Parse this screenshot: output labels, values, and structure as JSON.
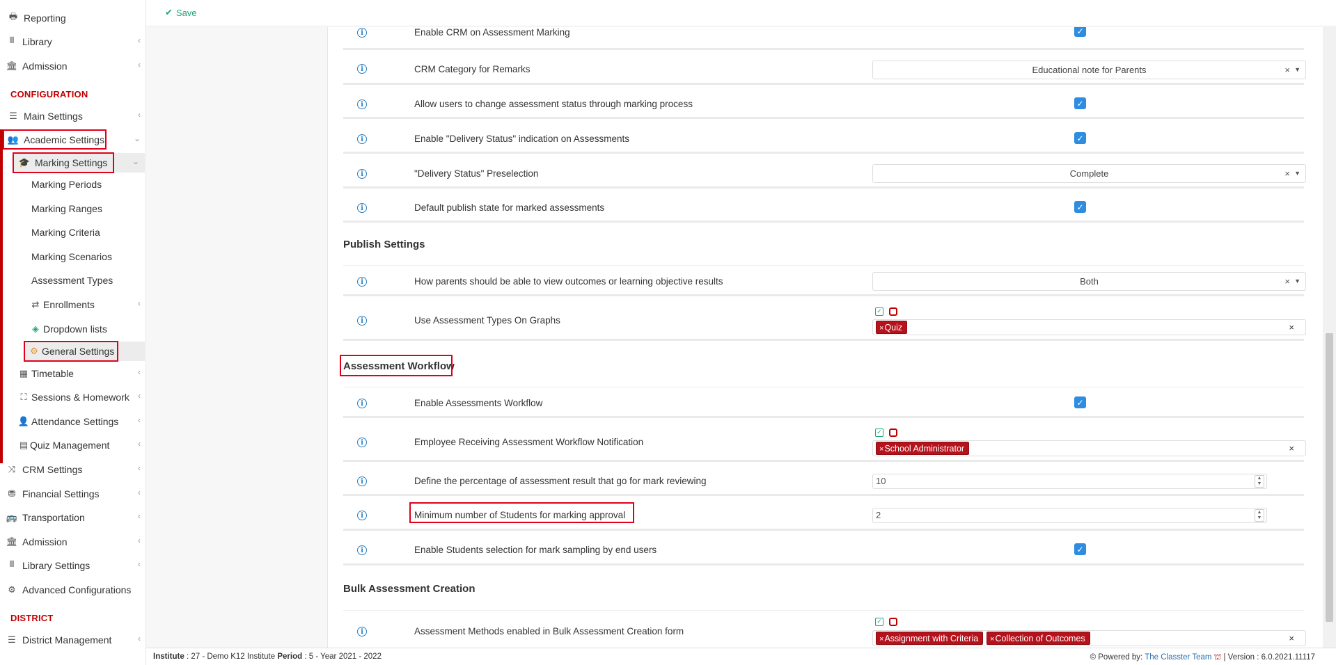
{
  "sidebar": {
    "top_items": [
      {
        "label": "Reporting",
        "icon": "printer-icon"
      },
      {
        "label": "Library",
        "icon": "books-icon"
      },
      {
        "label": "Admission",
        "icon": "institution-icon"
      }
    ],
    "config_header": "CONFIGURATION",
    "config_items": {
      "main_settings": "Main Settings",
      "academic_settings": "Academic Settings",
      "marking_settings": "Marking Settings",
      "marking_periods": "Marking Periods",
      "marking_ranges": "Marking Ranges",
      "marking_criteria": "Marking Criteria",
      "marking_scenarios": "Marking Scenarios",
      "assessment_types": "Assessment Types",
      "enrollments": "Enrollments",
      "dropdown_lists": "Dropdown lists",
      "general_settings": "General Settings",
      "timetable": "Timetable",
      "sessions_homework": "Sessions & Homework",
      "attendance_settings": "Attendance Settings",
      "quiz_management": "Quiz Management",
      "crm_settings": "CRM Settings",
      "financial_settings": "Financial Settings",
      "transportation": "Transportation",
      "admission": "Admission",
      "library_settings": "Library Settings",
      "advanced_configurations": "Advanced Configurations"
    },
    "district_header": "DISTRICT",
    "district_management": "District Management"
  },
  "toolbar": {
    "save_label": "Save"
  },
  "settings": {
    "enable_crm": "Enable CRM on Assessment Marking",
    "crm_category": "CRM Category for Remarks",
    "crm_category_value": "Educational note for Parents",
    "allow_status_change": "Allow users to change assessment status through marking process",
    "enable_delivery_status": "Enable \"Delivery Status\" indication on Assessments",
    "delivery_preselection": "\"Delivery Status\" Preselection",
    "delivery_preselection_value": "Complete",
    "default_publish": "Default publish state for marked assessments",
    "publish_settings_title": "Publish Settings",
    "parents_view": "How parents should be able to view outcomes or learning objective results",
    "parents_view_value": "Both",
    "use_types_graphs": "Use Assessment Types On Graphs",
    "use_types_graphs_tags": [
      "Quiz"
    ],
    "workflow_title": "Assessment Workflow",
    "enable_workflow": "Enable Assessments Workflow",
    "employee_notification": "Employee Receiving Assessment Workflow Notification",
    "employee_notification_tags": [
      "School Administrator"
    ],
    "percentage_review": "Define the percentage of assessment result that go for mark reviewing",
    "percentage_review_value": "10",
    "min_students": "Minimum number of Students for marking approval",
    "min_students_value": "2",
    "enable_students_selection": "Enable Students selection for mark sampling by end users",
    "bulk_title": "Bulk Assessment Creation",
    "bulk_methods": "Assessment Methods enabled in Bulk Assessment Creation form",
    "bulk_methods_tags": [
      "Assignment with Criteria",
      "Collection of Outcomes"
    ]
  },
  "footer": {
    "institute_label": "Institute",
    "institute_value": ": 27 - Demo K12 Institute",
    "period_label": "Period",
    "period_value": ": 5 - Year 2021 - 2022",
    "powered_by": "Powered by:",
    "team": "The Classter Team",
    "version": "| Version : 6.0.2021.11117"
  },
  "colors": {
    "accent_red": "#c00000",
    "checkbox_blue": "#2e8de0",
    "tag_red": "#b5121b",
    "save_green": "#1fa67a"
  }
}
